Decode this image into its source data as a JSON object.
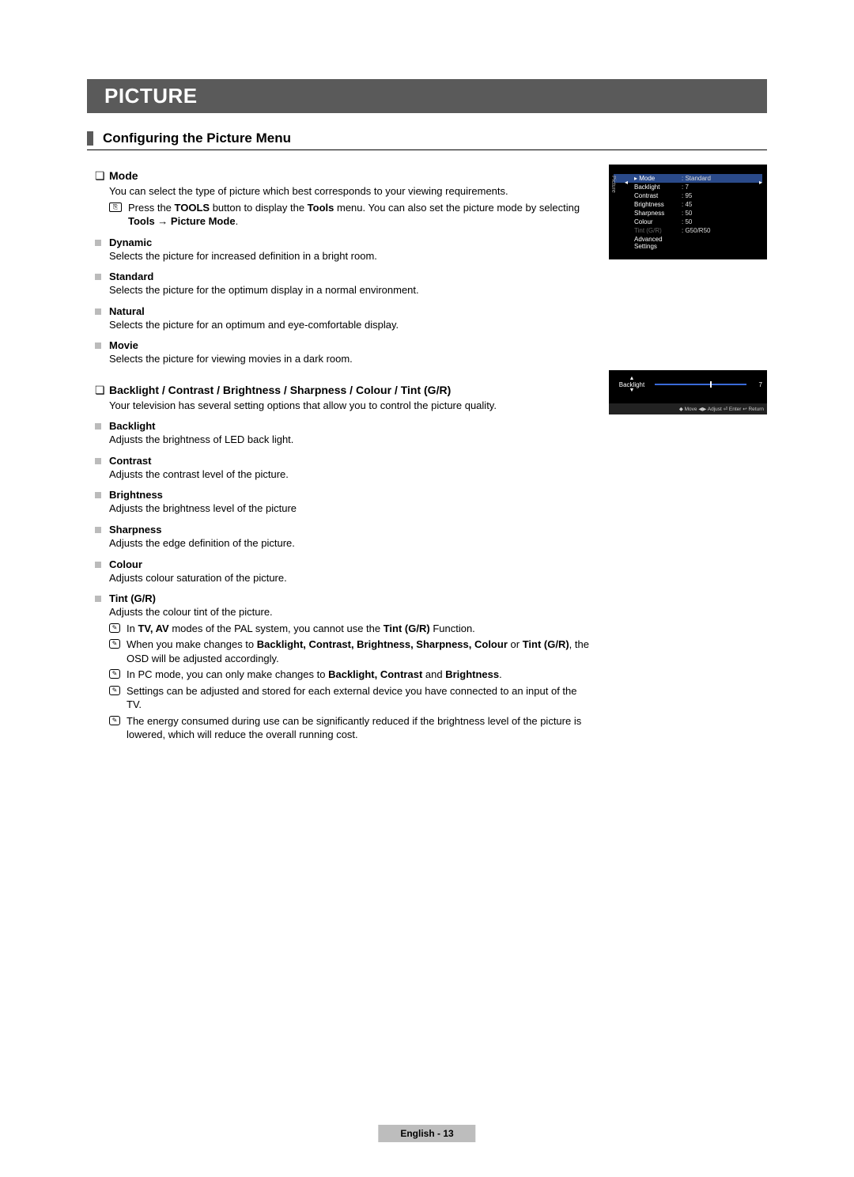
{
  "banner": "PICTURE",
  "section_title": "Configuring the Picture Menu",
  "mode": {
    "title": "Mode",
    "intro": "You can select the type of picture which best corresponds to your viewing requirements.",
    "tools_note_pre": "Press the ",
    "tools_word": "TOOLS",
    "tools_note_mid": " button to display the ",
    "tools_word2": "Tools",
    "tools_note_mid2": " menu. You can also set the picture mode by selecting ",
    "tools_path": "Tools → Picture Mode",
    "tools_note_end": ".",
    "items": [
      {
        "name": "Dynamic",
        "desc": "Selects the picture for increased definition in a bright room."
      },
      {
        "name": "Standard",
        "desc": "Selects the picture for the optimum display in a normal environment."
      },
      {
        "name": "Natural",
        "desc": "Selects the picture for an optimum and eye-comfortable display."
      },
      {
        "name": "Movie",
        "desc": "Selects the picture for viewing movies in a dark room."
      }
    ]
  },
  "adjust": {
    "title": "Backlight / Contrast / Brightness / Sharpness / Colour / Tint (G/R)",
    "intro": "Your television has several setting options that allow you to control the picture quality.",
    "items": [
      {
        "name": "Backlight",
        "desc": "Adjusts the brightness of LED back light."
      },
      {
        "name": "Contrast",
        "desc": "Adjusts the contrast level of the picture."
      },
      {
        "name": "Brightness",
        "desc": "Adjusts the brightness level of the picture"
      },
      {
        "name": "Sharpness",
        "desc": "Adjusts the edge definition of the picture."
      },
      {
        "name": "Colour",
        "desc": "Adjusts colour saturation of the picture."
      }
    ],
    "tint": {
      "name": "Tint (G/R)",
      "desc": "Adjusts the colour tint of the picture."
    },
    "notes": {
      "n1_pre": "In ",
      "n1_b1": "TV, AV",
      "n1_mid": " modes of the PAL system, you cannot use the ",
      "n1_b2": "Tint (G/R)",
      "n1_end": " Function.",
      "n2_pre": "When you make changes to ",
      "n2_b1": "Backlight, Contrast, Brightness, Sharpness, Colour",
      "n2_mid": " or ",
      "n2_b2": "Tint (G/R)",
      "n2_end": ", the OSD will be adjusted accordingly.",
      "n3_pre": "In PC mode, you can only make changes to ",
      "n3_b1": "Backlight, Contrast",
      "n3_mid": " and ",
      "n3_b2": "Brightness",
      "n3_end": ".",
      "n4": "Settings can be adjusted and stored for each external device you have connected to an input of the TV.",
      "n5": "The energy consumed during use can be significantly reduced if the brightness level of the picture is lowered, which will reduce the overall running cost."
    }
  },
  "osd1": {
    "side": "Picture",
    "rows": [
      {
        "label": "Mode",
        "val": ": Standard",
        "hl": true,
        "marker": "▸"
      },
      {
        "label": "Backlight",
        "val": ": 7"
      },
      {
        "label": "Contrast",
        "val": ": 95"
      },
      {
        "label": "Brightness",
        "val": ": 45"
      },
      {
        "label": "Sharpness",
        "val": ": 50"
      },
      {
        "label": "Colour",
        "val": ": 50"
      },
      {
        "label": "Tint (G/R)",
        "val": ": G50/R50",
        "dim": true
      },
      {
        "label": "Advanced Settings",
        "val": ""
      }
    ]
  },
  "osd2": {
    "label": "Backlight",
    "value": "7",
    "footer": "◆ Move   ◀▶ Adjust   ⏎ Enter   ↩ Return"
  },
  "footer": "English - 13"
}
